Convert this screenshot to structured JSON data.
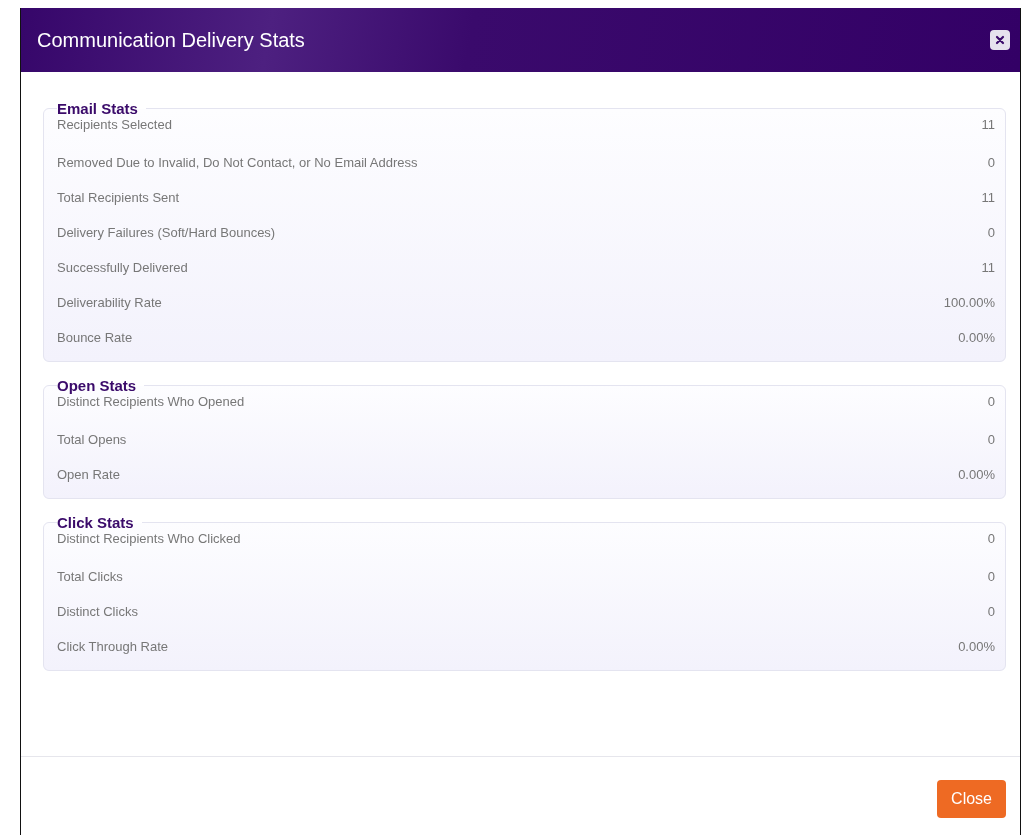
{
  "window": {
    "title": "Communication Delivery Stats"
  },
  "sections": [
    {
      "title": "Email Stats",
      "rows": [
        {
          "label": "Recipients Selected",
          "value": "11"
        },
        {
          "label": "Removed Due to Invalid, Do Not Contact, or No Email Address",
          "value": "0"
        },
        {
          "label": "Total Recipients Sent",
          "value": "11"
        },
        {
          "label": "Delivery Failures (Soft/Hard Bounces)",
          "value": "0"
        },
        {
          "label": "Successfully Delivered",
          "value": "11"
        },
        {
          "label": "Deliverability Rate",
          "value": "100.00%"
        },
        {
          "label": "Bounce Rate",
          "value": "0.00%"
        }
      ]
    },
    {
      "title": "Open Stats",
      "rows": [
        {
          "label": "Distinct Recipients Who Opened",
          "value": "0"
        },
        {
          "label": "Total Opens",
          "value": "0"
        },
        {
          "label": "Open Rate",
          "value": "0.00%"
        }
      ]
    },
    {
      "title": "Click Stats",
      "rows": [
        {
          "label": "Distinct Recipients Who Clicked",
          "value": "0"
        },
        {
          "label": "Total Clicks",
          "value": "0"
        },
        {
          "label": "Distinct Clicks",
          "value": "0"
        },
        {
          "label": "Click Through Rate",
          "value": "0.00%"
        }
      ]
    }
  ],
  "buttons": [
    {
      "label": "Close"
    }
  ]
}
